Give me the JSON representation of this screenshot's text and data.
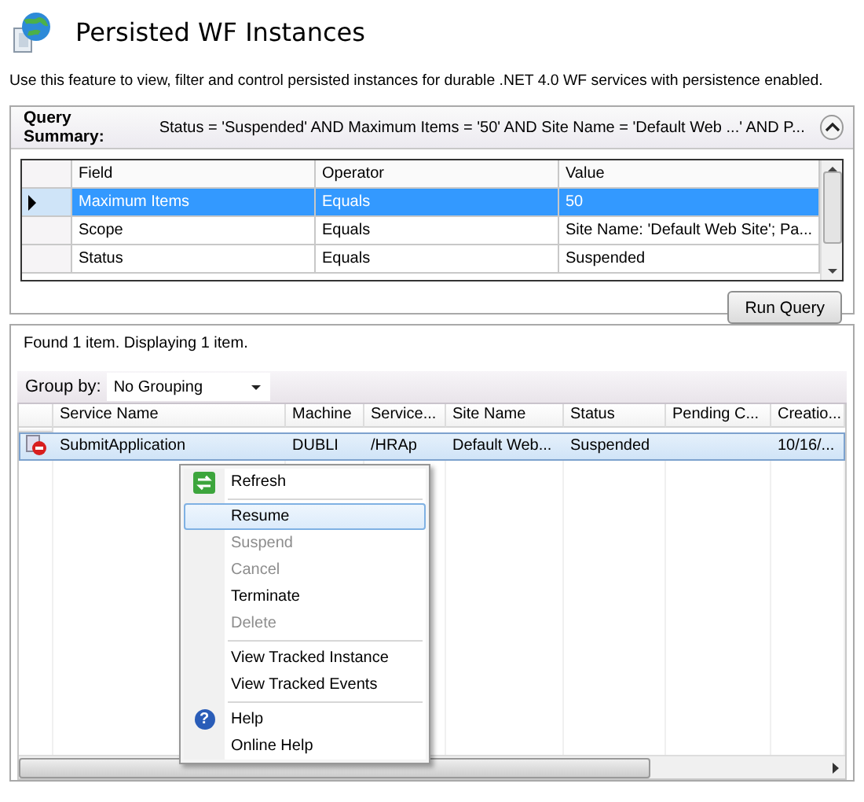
{
  "header": {
    "title": "Persisted WF Instances",
    "description": "Use this feature to view, filter and control persisted instances for durable .NET 4.0 WF services with persistence enabled."
  },
  "query": {
    "label": "Query Summary:",
    "summary": "Status = 'Suspended' AND Maximum Items = '50' AND Site Name = 'Default Web ...' AND P...",
    "expanded": true,
    "columns": [
      "Field",
      "Operator",
      "Value"
    ],
    "rows": [
      {
        "cells": [
          "Maximum Items",
          "Equals",
          "50"
        ],
        "selected": true
      },
      {
        "cells": [
          "Scope",
          "Equals",
          "Site Name: 'Default Web Site'; Pa..."
        ],
        "selected": false
      },
      {
        "cells": [
          "Status",
          "Equals",
          "Suspended"
        ],
        "selected": false
      }
    ],
    "run_button": "Run Query"
  },
  "results": {
    "status": "Found 1 item. Displaying 1 item.",
    "group_by_label": "Group by:",
    "group_by_value": "No Grouping",
    "columns": [
      "Service Name",
      "Machine",
      "Service...",
      "Site Name",
      "Status",
      "Pending C...",
      "Creatio..."
    ],
    "rows": [
      {
        "cells": [
          "SubmitApplication",
          "DUBLI",
          "/HRAp",
          "Default Web...",
          "Suspended",
          null,
          "10/16/..."
        ],
        "selected": true
      }
    ]
  },
  "context_menu": {
    "sections": [
      [
        {
          "label": "Refresh",
          "selected": false,
          "disabled": false
        }
      ],
      [
        {
          "label": "Resume",
          "selected": true,
          "disabled": false
        },
        {
          "label": "Suspend",
          "selected": false,
          "disabled": true
        },
        {
          "label": "Cancel",
          "selected": false,
          "disabled": true
        },
        {
          "label": "Terminate",
          "selected": false,
          "disabled": false
        },
        {
          "label": "Delete",
          "selected": false,
          "disabled": true
        }
      ],
      [
        {
          "label": "View Tracked Instance",
          "selected": false,
          "disabled": false
        },
        {
          "label": "View Tracked Events",
          "selected": false,
          "disabled": false
        }
      ],
      [
        {
          "label": "Help",
          "selected": false,
          "disabled": false,
          "icon_text": "?"
        },
        {
          "label": "Online Help",
          "selected": false,
          "disabled": false
        }
      ]
    ]
  }
}
